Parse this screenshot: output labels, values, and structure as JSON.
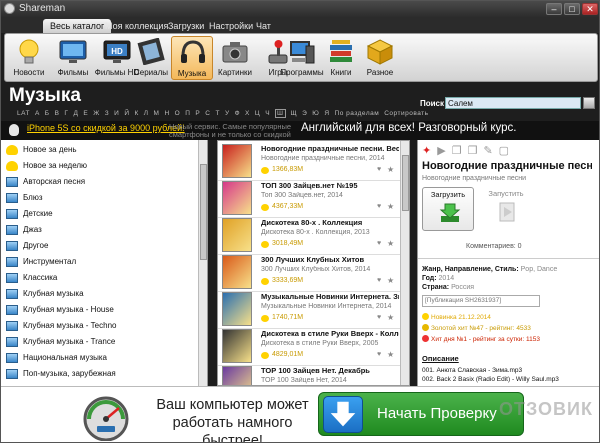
{
  "window": {
    "title": "Shareman",
    "buttons": [
      "–",
      "□",
      "✕"
    ]
  },
  "menu_tabs": [
    "Весь каталог",
    "Моя коллекция",
    "Загрузки",
    "Настройки",
    "Чат"
  ],
  "categories": [
    {
      "label": "Новости",
      "icon": "lightbulb-icon"
    },
    {
      "label": "Фильмы",
      "icon": "tv-icon"
    },
    {
      "label": "Фильмы HD",
      "icon": "hd-tv-icon"
    },
    {
      "label": "Сериалы",
      "icon": "film-strip-icon"
    },
    {
      "label": "Музыка",
      "icon": "headphones-icon"
    },
    {
      "label": "Картинки",
      "icon": "camera-icon"
    },
    {
      "label": "Игры",
      "icon": "joystick-icon"
    },
    {
      "label": "Программы",
      "icon": "computer-icon"
    },
    {
      "label": "Книги",
      "icon": "books-icon"
    },
    {
      "label": "Разное",
      "icon": "box-icon"
    }
  ],
  "section_title": "Музыка",
  "alphabet": [
    "LAT",
    "А",
    "Б",
    "В",
    "Г",
    "Д",
    "Е",
    "Ж",
    "З",
    "И",
    "Й",
    "К",
    "Л",
    "М",
    "Н",
    "О",
    "П",
    "Р",
    "С",
    "Т",
    "У",
    "Ф",
    "Х",
    "Ц",
    "Ч",
    "Ш",
    "Щ",
    "Э",
    "Ю",
    "Я",
    "По разделам",
    "Сортировать"
  ],
  "search": {
    "label": "Поиск",
    "value": "Салем"
  },
  "ad_strip": {
    "link": "iPhone 5S со скидкой за 9000 рублей!",
    "grey": "Новый сервис. Самые популярные смартфоны и не только со скидкой до 90% стоимости!",
    "right": "Английский для всех! Разговорный курс."
  },
  "left_items": [
    {
      "label": "Новое за день",
      "icon": "bulb"
    },
    {
      "label": "Новое за неделю",
      "icon": "bulb"
    },
    {
      "label": "Авторская песня",
      "icon": "monitor"
    },
    {
      "label": "Блюз",
      "icon": "monitor"
    },
    {
      "label": "Детские",
      "icon": "monitor"
    },
    {
      "label": "Джаз",
      "icon": "monitor"
    },
    {
      "label": "Другое",
      "icon": "monitor"
    },
    {
      "label": "Инструментал",
      "icon": "monitor"
    },
    {
      "label": "Классика",
      "icon": "monitor"
    },
    {
      "label": "Клубная музыка",
      "icon": "monitor"
    },
    {
      "label": "Клубная музыка - House",
      "icon": "monitor"
    },
    {
      "label": "Клубная музыка - Techno",
      "icon": "monitor"
    },
    {
      "label": "Клубная музыка - Trance",
      "icon": "monitor"
    },
    {
      "label": "Национальная музыка",
      "icon": "monitor"
    },
    {
      "label": "Поп-музыка, зарубежная",
      "icon": "monitor"
    }
  ],
  "mid_items": [
    {
      "title": "Новогодние праздничные песни. Весел",
      "sub": "Новогодние праздничные песни, 2014",
      "size": "1366,83M",
      "cover": "#c8201e"
    },
    {
      "title": "ТОП 300 Зайцев.нет №195",
      "sub": "Топ 300 Зайцев.нет, 2014",
      "size": "4367,33M",
      "cover": "#d6388a"
    },
    {
      "title": "Дискотека 80-х . Коллекция",
      "sub": "Дискотека 80-х . Коллекция, 2013",
      "size": "3018,49M",
      "cover": "#e0a126"
    },
    {
      "title": "300 Лучших Клубных Хитов",
      "sub": "300 Лучших Клубных Хитов, 2014",
      "size": "3333,69M",
      "cover": "#d95a1a"
    },
    {
      "title": "Музыкальные Новинки Интернета. Зим",
      "sub": "Музыкальные Новинки Интернета, 2014",
      "size": "1740,71M",
      "cover": "#2a6fb0"
    },
    {
      "title": "Дискотека в стиле Руки Вверх - Коллек",
      "sub": "Дискотека в стиле Руки Вверх, 2005",
      "size": "4829,01M",
      "cover": "#333333"
    },
    {
      "title": "ТОР 100 Зайцев Нет. Декабрь",
      "sub": "ТОР 100 Зайцев Нет, 2014",
      "size": "",
      "cover": "#6a3aa0"
    }
  ],
  "details": {
    "title": "Новогодние праздничные песн...",
    "subtitle": "Новогодние праздничные песни",
    "download_label": "Загрузить",
    "run_label": "Запустить",
    "comments": "Комментариев: 0",
    "genre_label": "Жанр, Направление, Стиль:",
    "genre_value": "Pop, Dance",
    "year_label": "Год:",
    "year_value": "2014",
    "country_label": "Страна:",
    "country_value": "Россия",
    "publication": "[Публикация SH2631937]",
    "badges": [
      {
        "text": "Новинка 21.12.2014",
        "color": "#e0a800",
        "dot": "#ffd200"
      },
      {
        "text": "Золотой хит №47 - рейтинг: 4533",
        "color": "#c89a00",
        "dot": "#e6b800"
      },
      {
        "text": "Хит дня №1 - рейтинг за сутки: 1153",
        "color": "#cc2200",
        "dot": "#e33"
      }
    ],
    "description_title": "Описание",
    "tracks": [
      "001. Анюта Славская - Зима.mp3",
      "002. Back 2 Basix (Radio Edit) - Willy Saul.mp3"
    ]
  },
  "banner": {
    "text": "Ваш компьютер может работать намного быстрее!",
    "button": "Начать Проверку",
    "watermark": "ОТЗОВИК"
  }
}
